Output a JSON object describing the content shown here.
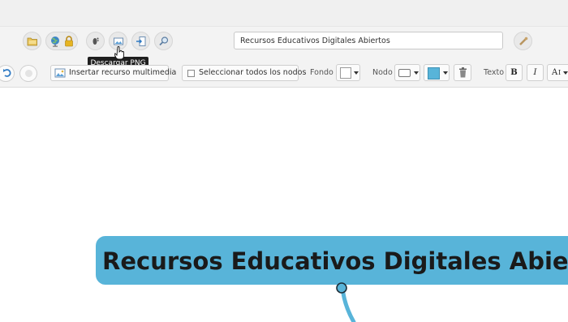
{
  "header": {
    "title_value": "Recursos Educativos Digitales Abiertos"
  },
  "toolbar1": {
    "icons": [
      "folder-icon",
      "globe-icon",
      "lock-icon",
      "footprint-icon",
      "image-icon",
      "import-icon",
      "zoom-icon",
      "share-icon"
    ],
    "tooltip": "Descargar PNG"
  },
  "toolbar2": {
    "insert_media_label": "Insertar recurso multimedia",
    "select_all_label": "Seleccionar todos los nodos",
    "background_label": "Fondo",
    "node_label": "Nodo",
    "text_label": "Texto",
    "bold_label": "B",
    "italic_label": "I",
    "font_size_label": "A",
    "colors": {
      "background_swatch": "#ffffff",
      "node_border_swatch": "#ffffff",
      "node_fill_swatch": "#58b4d9"
    }
  },
  "mindmap": {
    "central_node_text": "Recursos Educativos Digitales Abiertos",
    "node_color": "#58b4d9"
  }
}
